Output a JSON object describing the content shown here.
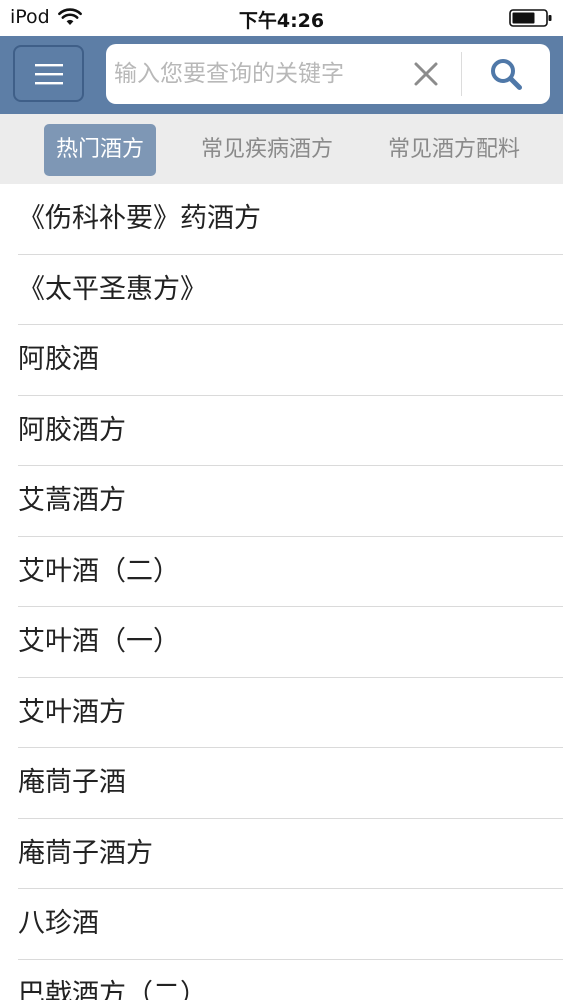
{
  "status_bar": {
    "carrier": "iPod",
    "time": "下午4:26"
  },
  "icons": {
    "wifi": "wifi-icon",
    "battery": "battery-icon",
    "menu": "hamburger-menu-icon",
    "clear": "close-icon",
    "search": "search-icon"
  },
  "search": {
    "placeholder": "输入您要查询的关键字",
    "value": ""
  },
  "tabs": [
    {
      "label": "热门酒方",
      "active": true
    },
    {
      "label": "常见疾病酒方",
      "active": false
    },
    {
      "label": "常见酒方配料",
      "active": false
    }
  ],
  "list": {
    "items": [
      "《伤科补要》药酒方",
      "《太平圣惠方》",
      "阿胶酒",
      "阿胶酒方",
      "艾蒿酒方",
      "艾叶酒（二）",
      "艾叶酒（一）",
      "艾叶酒方",
      "庵茼子酒",
      "庵茼子酒方",
      "八珍酒",
      "巴戟酒方（二）"
    ]
  },
  "colors": {
    "header": "#5d7ea6",
    "tab_active": "#7e97b5",
    "tab_bar": "#ececec"
  }
}
